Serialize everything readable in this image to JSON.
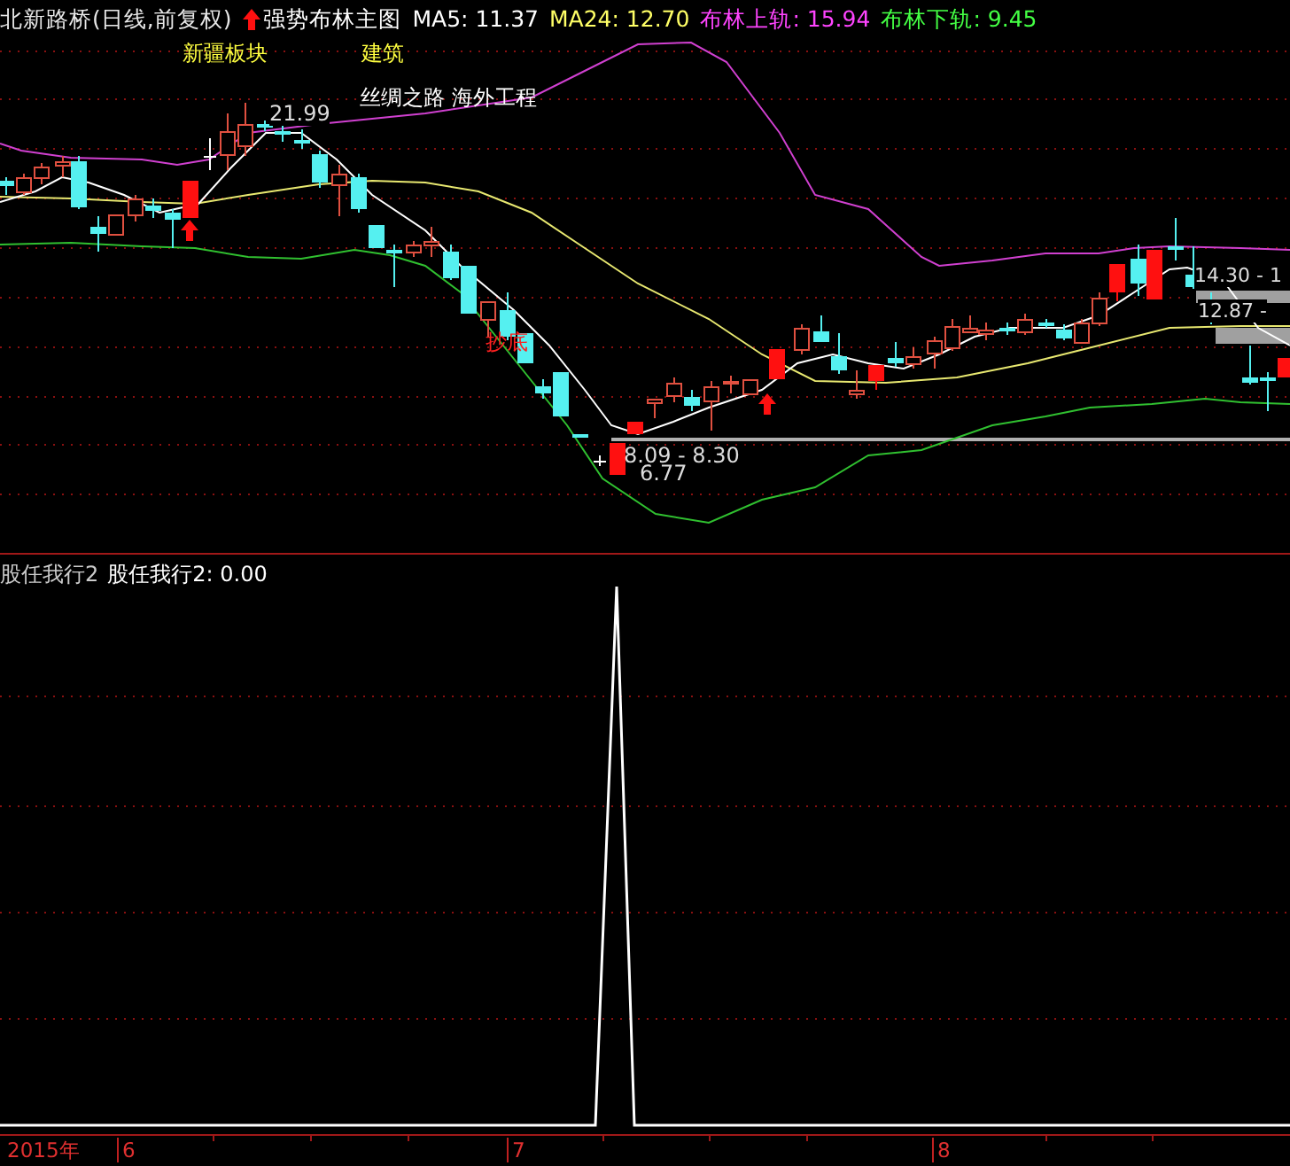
{
  "header": {
    "stock": "北新路桥(日线,前复权)",
    "indicator": "强势布林主图",
    "values": [
      {
        "label": "MA5: 11.37",
        "color": "#ffffff"
      },
      {
        "label": "MA24: 12.70",
        "color": "#ffff66"
      },
      {
        "label": "布林上轨: 15.94",
        "color": "#ff44ff"
      },
      {
        "label": "布林下轨: 9.45",
        "color": "#44ff44"
      }
    ]
  },
  "price_chart": {
    "annotations": [
      {
        "text": "新疆板块"
      },
      {
        "text": "建筑"
      },
      {
        "text": "丝绸之路 海外工程"
      },
      {
        "text": "21.99"
      },
      {
        "text": "抄底"
      },
      {
        "text": "8.09 - 8.30"
      },
      {
        "text": "6.77"
      },
      {
        "text": "14.30 - 1"
      },
      {
        "text": "12.87 -"
      }
    ]
  },
  "indicator_panel": {
    "name": "股任我行2",
    "reading": "股任我行2: 0.00"
  },
  "time_axis": {
    "labels": [
      "2015年",
      "6",
      "7",
      "8"
    ]
  }
}
